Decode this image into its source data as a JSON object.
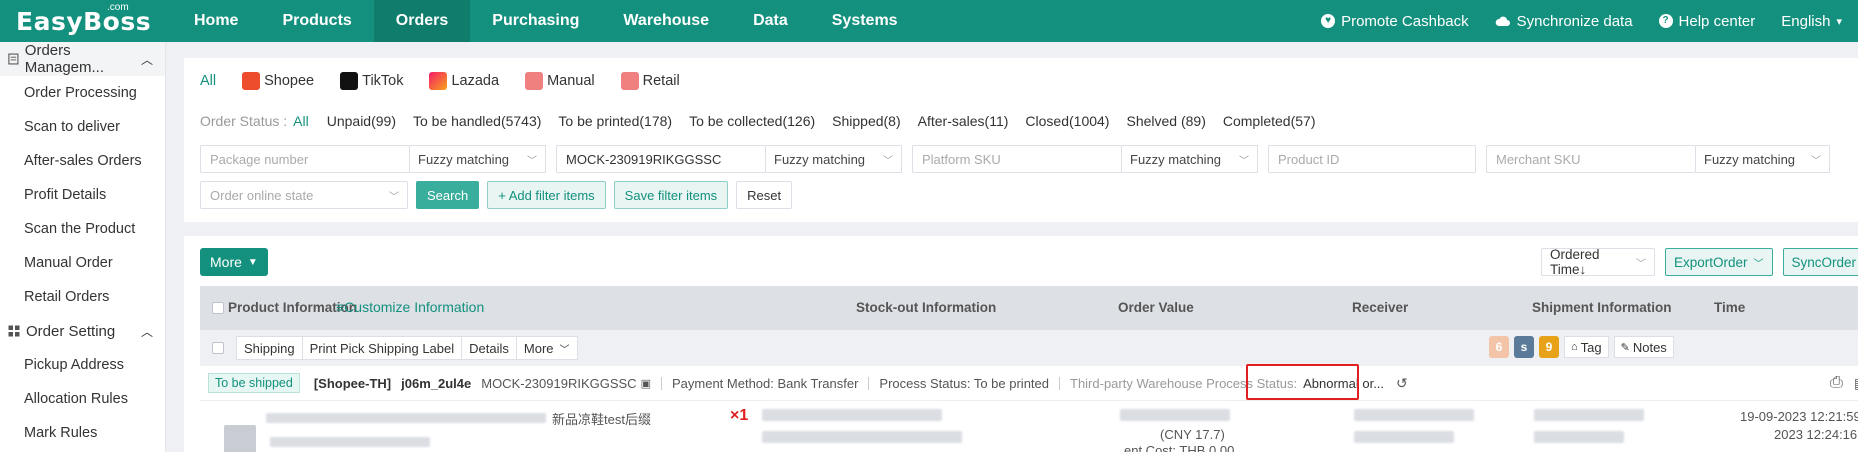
{
  "brand": {
    "name": "EasyBoss",
    "suffix": ".com"
  },
  "nav": [
    "Home",
    "Products",
    "Orders",
    "Purchasing",
    "Warehouse",
    "Data",
    "Systems"
  ],
  "top_right": {
    "promote": "Promote Cashback",
    "sync": "Synchronize data",
    "help": "Help center",
    "lang": "English"
  },
  "sidebar": {
    "group1": "Orders Managem...",
    "items1": [
      "Order Processing",
      "Scan to deliver",
      "After-sales Orders",
      "Profit Details",
      "Scan the Product",
      "Manual Order",
      "Retail Orders"
    ],
    "group2": "Order Setting",
    "items2": [
      "Pickup Address",
      "Allocation Rules",
      "Mark Rules"
    ]
  },
  "platforms": [
    "All",
    "Shopee",
    "TikTok",
    "Lazada",
    "Manual",
    "Retail"
  ],
  "status": {
    "label": "Order Status :",
    "items": [
      "All",
      "Unpaid(99)",
      "To be handled(5743)",
      "To be printed(178)",
      "To be collected(126)",
      "Shipped(8)",
      "After-sales(11)",
      "Closed(1004)",
      "Shelved (89)",
      "Completed(57)"
    ]
  },
  "filters": {
    "package_ph": "Package number",
    "fuzzy": "Fuzzy matching",
    "order_value": "MOCK-230919RIKGGSSC",
    "platform_sku_ph": "Platform SKU",
    "product_id_ph": "Product ID",
    "merchant_sku_ph": "Merchant SKU",
    "online_state_ph": "Order online state",
    "search": "Search",
    "add_filter": "+ Add filter items",
    "save_filter": "Save filter items",
    "reset": "Reset"
  },
  "list": {
    "more": "More",
    "ordered_time": "Ordered Time↓",
    "export": "ExportOrder",
    "sync": "SyncOrder",
    "headers": {
      "product": "Product Information",
      "customize": "≡Customize Information",
      "stock": "Stock-out Information",
      "value": "Order Value",
      "receiver": "Receiver",
      "shipment": "Shipment Information",
      "time": "Time"
    },
    "ops": [
      "Shipping",
      "Print Pick Shipping Label",
      "Details",
      "More"
    ],
    "badges": [
      "6",
      "s",
      "9"
    ],
    "tag": "Tag",
    "notes": "Notes",
    "order": {
      "status": "To be shipped",
      "shop": "[Shopee-TH]",
      "account": "j06m_2ul4e",
      "order_no": "MOCK-230919RIKGGSSC",
      "payment": "Payment Method: Bank Transfer",
      "process": "Process Status: To be printed",
      "third_party_label": "Third-party Warehouse Process Status:",
      "third_party_value": "Abnormal or...",
      "product_name": "新品凉鞋test后缀",
      "qty": "×1",
      "currency": "(CNY 17.7)",
      "cost": "ent Cost: THB 0.00",
      "time1": "19-09-2023 12:21:59",
      "time2": "2023 12:24:16"
    }
  }
}
